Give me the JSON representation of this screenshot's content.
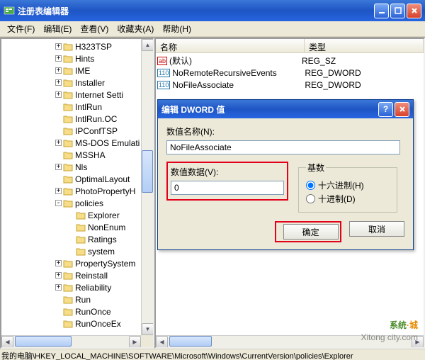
{
  "window": {
    "title": "注册表编辑器"
  },
  "menu": {
    "file": "文件(F)",
    "edit": "编辑(E)",
    "view": "查看(V)",
    "fav": "收藏夹(A)",
    "help": "帮助(H)"
  },
  "tree": [
    {
      "depth": 2,
      "exp": "+",
      "label": "H323TSP"
    },
    {
      "depth": 2,
      "exp": "+",
      "label": "Hints"
    },
    {
      "depth": 2,
      "exp": "+",
      "label": "IME"
    },
    {
      "depth": 2,
      "exp": "+",
      "label": "Installer"
    },
    {
      "depth": 2,
      "exp": "+",
      "label": "Internet Setti"
    },
    {
      "depth": 2,
      "exp": "",
      "label": "IntlRun"
    },
    {
      "depth": 2,
      "exp": "",
      "label": "IntlRun.OC"
    },
    {
      "depth": 2,
      "exp": "",
      "label": "IPConfTSP"
    },
    {
      "depth": 2,
      "exp": "+",
      "label": "MS-DOS Emulati"
    },
    {
      "depth": 2,
      "exp": "",
      "label": "MSSHA"
    },
    {
      "depth": 2,
      "exp": "+",
      "label": "Nls"
    },
    {
      "depth": 2,
      "exp": "",
      "label": "OptimalLayout"
    },
    {
      "depth": 2,
      "exp": "+",
      "label": "PhotoPropertyH"
    },
    {
      "depth": 2,
      "exp": "-",
      "label": "policies"
    },
    {
      "depth": 3,
      "exp": "",
      "label": "Explorer"
    },
    {
      "depth": 3,
      "exp": "",
      "label": "NonEnum"
    },
    {
      "depth": 3,
      "exp": "",
      "label": "Ratings"
    },
    {
      "depth": 3,
      "exp": "",
      "label": "system"
    },
    {
      "depth": 2,
      "exp": "+",
      "label": "PropertySystem"
    },
    {
      "depth": 2,
      "exp": "+",
      "label": "Reinstall"
    },
    {
      "depth": 2,
      "exp": "+",
      "label": "Reliability"
    },
    {
      "depth": 2,
      "exp": "",
      "label": "Run"
    },
    {
      "depth": 2,
      "exp": "",
      "label": "RunOnce"
    },
    {
      "depth": 2,
      "exp": "",
      "label": "RunOnceEx"
    }
  ],
  "list": {
    "col_name": "名称",
    "col_type": "类型",
    "rows": [
      {
        "icon": "sz",
        "name": "(默认)",
        "type": "REG_SZ"
      },
      {
        "icon": "dw",
        "name": "NoRemoteRecursiveEvents",
        "type": "REG_DWORD"
      },
      {
        "icon": "dw",
        "name": "NoFileAssociate",
        "type": "REG_DWORD"
      }
    ]
  },
  "dialog": {
    "title": "编辑 DWORD 值",
    "name_label": "数值名称(N):",
    "name_value": "NoFileAssociate",
    "data_label": "数值数据(V):",
    "data_value": "0",
    "base_legend": "基数",
    "radio_hex": "十六进制(H)",
    "radio_dec": "十进制(D)",
    "ok": "确定",
    "cancel": "取消"
  },
  "statusbar": "我的电脑\\HKEY_LOCAL_MACHINE\\SOFTWARE\\Microsoft\\Windows\\CurrentVersion\\policies\\Explorer",
  "watermark": {
    "brand": "系统",
    "suffix": "·城",
    "url": "Xitong city.com"
  }
}
